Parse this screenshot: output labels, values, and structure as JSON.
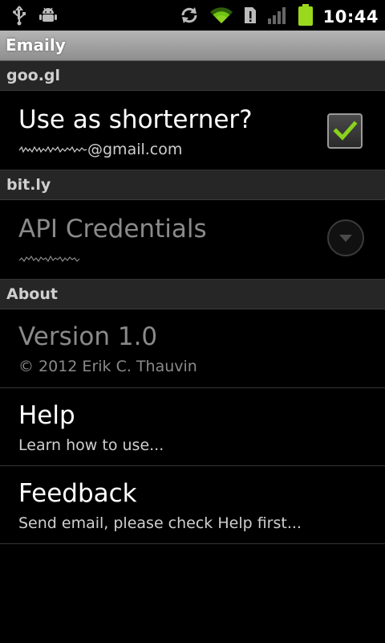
{
  "statusbar": {
    "time": "10:44",
    "icons": [
      "usb-icon",
      "android-debug-icon",
      "sync-icon",
      "wifi-icon",
      "sim-alert-icon",
      "signal-icon",
      "battery-icon"
    ]
  },
  "app": {
    "title": "Emaily"
  },
  "sections": {
    "googl": {
      "header": "goo.gl",
      "shortener_title": "Use as shorterner?",
      "shortener_summary_suffix": "@gmail.com",
      "shortener_checked": true
    },
    "bitly": {
      "header": "bit.ly",
      "credentials_title": "API Credentials"
    },
    "about": {
      "header": "About",
      "version_title": "Version 1.0",
      "version_summary": "© 2012 Erik C. Thauvin",
      "help_title": "Help",
      "help_summary": "Learn how to use...",
      "feedback_title": "Feedback",
      "feedback_summary": "Send email, please check Help first..."
    }
  },
  "colors": {
    "accent_check": "#8ad21e",
    "battery": "#9ad81d"
  }
}
